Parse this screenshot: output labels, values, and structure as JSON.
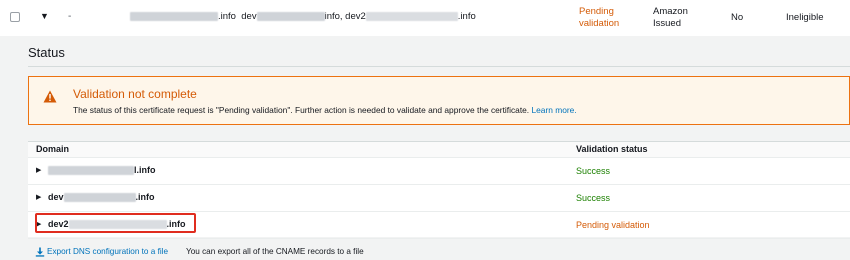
{
  "certificate_row": {
    "expand_caret": "▼",
    "dash": "-",
    "domain_prefix_1": "",
    "domain_suffix_1": ".info",
    "domain_prefix_2": "dev",
    "domain_suffix_2": "info, dev2",
    "domain_suffix_3": ".info",
    "status_line1": "Pending",
    "status_line2": "validation",
    "type_line1": "Amazon",
    "type_line2": "Issued",
    "in_use": "No",
    "renewal_eligibility": "Ineligible"
  },
  "status_section": {
    "heading": "Status"
  },
  "alert": {
    "title": "Validation not complete",
    "message": "The status of this certificate request is \"Pending validation\". Further action is needed to validate and approve the certificate.",
    "link": "Learn more."
  },
  "domains_table": {
    "columns": [
      "Domain",
      "Validation status"
    ],
    "rows": [
      {
        "prefix": "",
        "suffix": "l.info",
        "status": "Success",
        "state": "success"
      },
      {
        "prefix": "dev",
        "suffix": ".info",
        "status": "Success",
        "state": "success"
      },
      {
        "prefix": "dev2",
        "suffix": ".info",
        "status": "Pending validation",
        "state": "pending"
      }
    ]
  },
  "export": {
    "link": "Export DNS configuration to a file",
    "hint": "You can export all of the CNAME records to a file"
  },
  "colors": {
    "pending": "#d45b07",
    "success": "#1d8102",
    "link": "#0073bb",
    "highlight_border": "#e02d1f",
    "alert_border": "#ec7211"
  }
}
